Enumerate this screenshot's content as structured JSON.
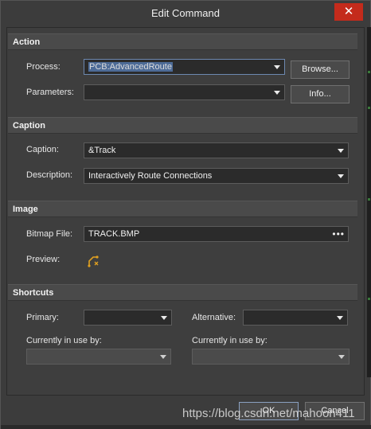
{
  "window": {
    "title": "Edit Command",
    "close_glyph": "✕"
  },
  "action": {
    "header": "Action",
    "process_label": "Process:",
    "process_value": "PCB:AdvancedRoute",
    "parameters_label": "Parameters:",
    "parameters_value": "",
    "browse_label": "Browse...",
    "info_label": "Info..."
  },
  "caption": {
    "header": "Caption",
    "caption_label": "Caption:",
    "caption_value": "&Track",
    "description_label": "Description:",
    "description_value": "Interactively Route Connections"
  },
  "image": {
    "header": "Image",
    "bitmap_label": "Bitmap File:",
    "bitmap_value": "TRACK.BMP",
    "browse_dots": "•••",
    "preview_label": "Preview:",
    "preview_icon": "route-track-icon"
  },
  "shortcuts": {
    "header": "Shortcuts",
    "primary_label": "Primary:",
    "primary_value": "",
    "alternative_label": "Alternative:",
    "alternative_value": "",
    "in_use_label_1": "Currently in use by:",
    "in_use_value_1": "",
    "in_use_label_2": "Currently in use by:",
    "in_use_value_2": ""
  },
  "footer": {
    "ok_label": "OK",
    "cancel_label": "Cancel"
  },
  "watermark": "https://blog.csdn.net/mahoon411",
  "colors": {
    "close": "#c42b1c",
    "selection": "#4d6b97",
    "icon": "#e0a020"
  }
}
